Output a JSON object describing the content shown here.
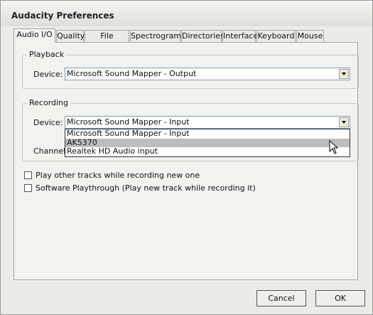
{
  "window": {
    "title": "Audacity Preferences"
  },
  "tabs": [
    {
      "label": "Audio I/O",
      "active": true
    },
    {
      "label": "Quality"
    },
    {
      "label": "File Formats"
    },
    {
      "label": "Spectrograms"
    },
    {
      "label": "Directories"
    },
    {
      "label": "Interface"
    },
    {
      "label": "Keyboard"
    },
    {
      "label": "Mouse"
    }
  ],
  "playback": {
    "group_label": "Playback",
    "device_label": "Device:",
    "device_value": "Microsoft Sound Mapper - Output"
  },
  "recording": {
    "group_label": "Recording",
    "device_label": "Device:",
    "device_value": "Microsoft Sound Mapper - Input",
    "channels_label": "Channels",
    "dropdown_options": [
      {
        "label": "Microsoft Sound Mapper - Input"
      },
      {
        "label": "AK5370",
        "highlighted": true
      },
      {
        "label": "Realtek HD Audio input"
      }
    ]
  },
  "options": {
    "play_other_tracks": {
      "label": "Play other tracks while recording new one",
      "checked": false
    },
    "software_playthrough": {
      "label": "Software Playthrough (Play new track while recording it)",
      "checked": false
    }
  },
  "buttons": {
    "cancel": "Cancel",
    "ok": "OK"
  },
  "icons": {
    "dropdown_arrow": "chevron-down-icon",
    "cursor": "mouse-pointer-icon"
  }
}
